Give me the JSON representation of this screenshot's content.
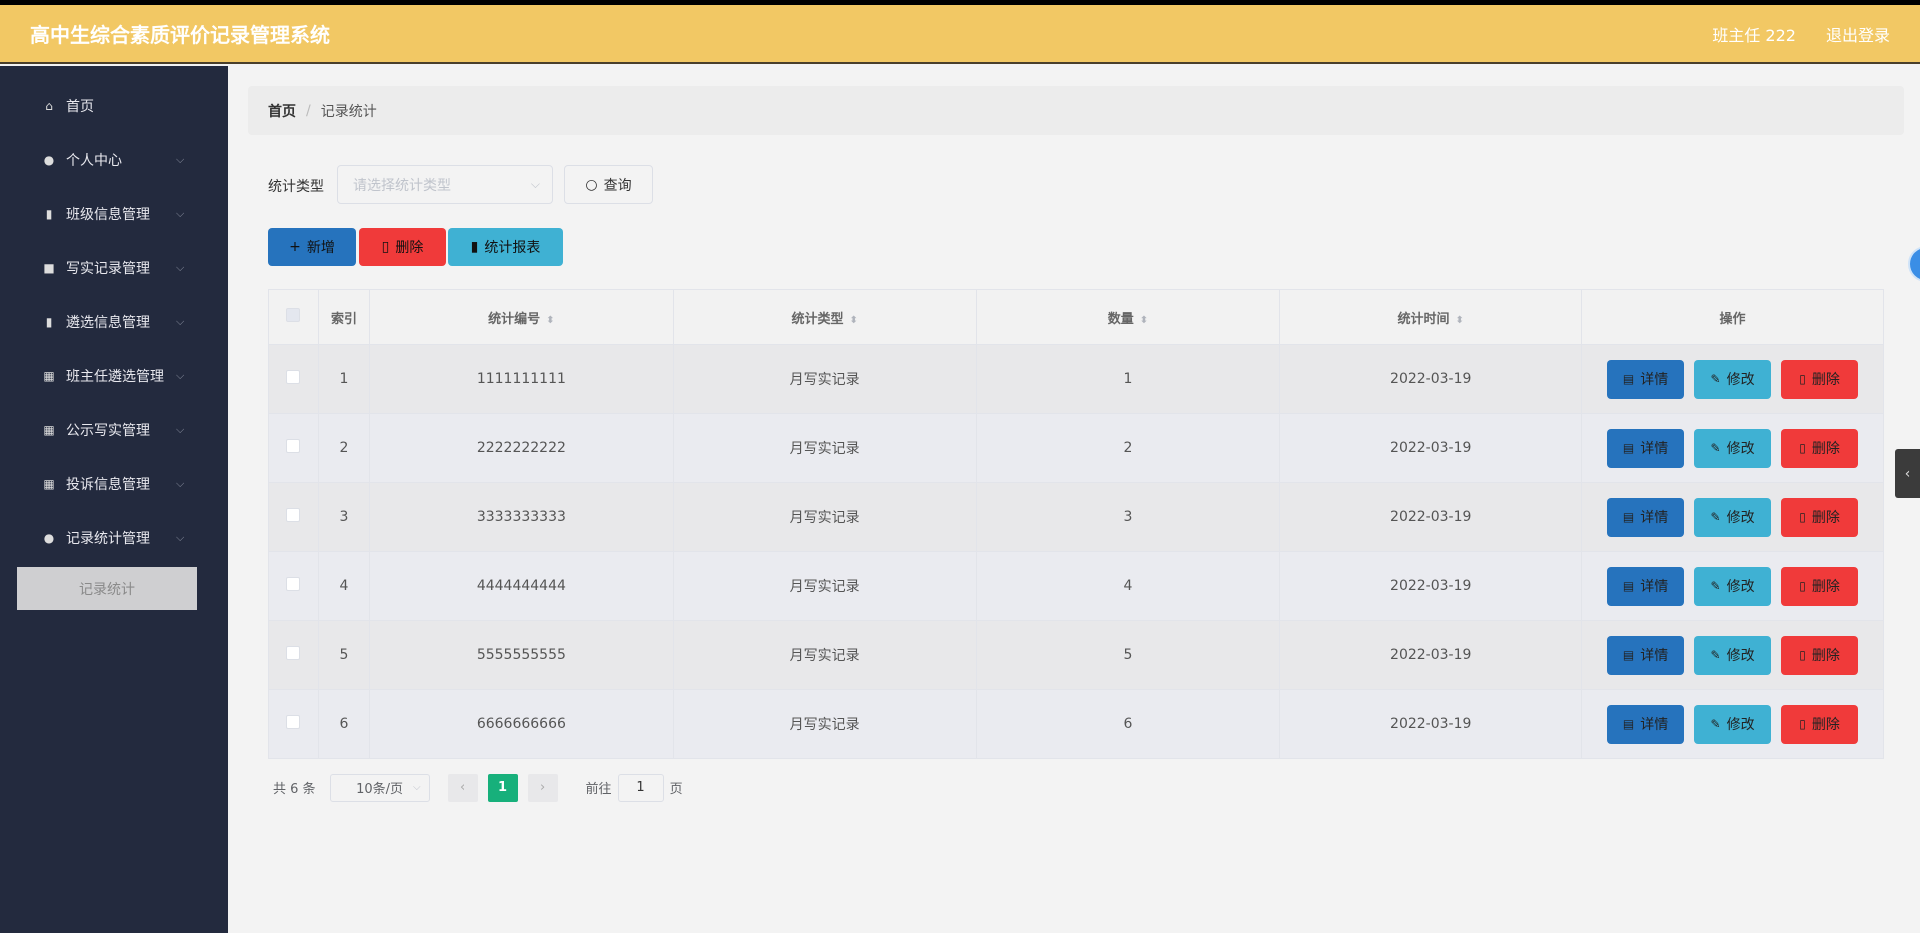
{
  "header": {
    "title": "高中生综合素质评价记录管理系统",
    "user": "班主任 222",
    "logout": "退出登录"
  },
  "sidebar": {
    "items": [
      {
        "label": "首页",
        "icon": "home-icon",
        "glyph": "⌂",
        "chev": false
      },
      {
        "label": "个人中心",
        "icon": "user-icon",
        "glyph": "●",
        "chev": true
      },
      {
        "label": "班级信息管理",
        "icon": "bar-chart-icon",
        "glyph": "▮",
        "chev": true
      },
      {
        "label": "写实记录管理",
        "icon": "notebook-icon",
        "glyph": "■",
        "chev": true
      },
      {
        "label": "遴选信息管理",
        "icon": "book-icon",
        "glyph": "▮",
        "chev": true
      },
      {
        "label": "班主任遴选管理",
        "icon": "grid-icon",
        "glyph": "▦",
        "chev": true
      },
      {
        "label": "公示写实管理",
        "icon": "grid-icon",
        "glyph": "▦",
        "chev": true
      },
      {
        "label": "投诉信息管理",
        "icon": "grid-icon",
        "glyph": "▦",
        "chev": true
      },
      {
        "label": "记录统计管理",
        "icon": "bulb-icon",
        "glyph": "●",
        "chev": true
      }
    ],
    "sub_item": "记录统计"
  },
  "breadcrumb": {
    "home": "首页",
    "sep": "/",
    "current": "记录统计"
  },
  "filter": {
    "label": "统计类型",
    "placeholder": "请选择统计类型",
    "query": "查询"
  },
  "toolbar": {
    "add": "新增",
    "delete": "删除",
    "report": "统计报表"
  },
  "table": {
    "headers": [
      "索引",
      "统计编号",
      "统计类型",
      "数量",
      "统计时间",
      "操作"
    ],
    "rows": [
      {
        "index": "1",
        "code": "1111111111",
        "type": "月写实记录",
        "count": "1",
        "time": "2022-03-19"
      },
      {
        "index": "2",
        "code": "2222222222",
        "type": "月写实记录",
        "count": "2",
        "time": "2022-03-19"
      },
      {
        "index": "3",
        "code": "3333333333",
        "type": "月写实记录",
        "count": "3",
        "time": "2022-03-19"
      },
      {
        "index": "4",
        "code": "4444444444",
        "type": "月写实记录",
        "count": "4",
        "time": "2022-03-19"
      },
      {
        "index": "5",
        "code": "5555555555",
        "type": "月写实记录",
        "count": "5",
        "time": "2022-03-19"
      },
      {
        "index": "6",
        "code": "6666666666",
        "type": "月写实记录",
        "count": "6",
        "time": "2022-03-19"
      }
    ],
    "actions": {
      "detail": "详情",
      "edit": "修改",
      "delete": "删除"
    }
  },
  "pagination": {
    "total": "共 6 条",
    "page_size": "10条/页",
    "current": "1",
    "goto_label": "前往",
    "goto_value": "1",
    "page_suffix": "页"
  },
  "colors": {
    "header": "#f2c864",
    "sidebar": "#232a3e",
    "primary": "#2673bd",
    "danger": "#f03a3a",
    "info": "#3fb1d3",
    "pager_active": "#17b07b"
  }
}
